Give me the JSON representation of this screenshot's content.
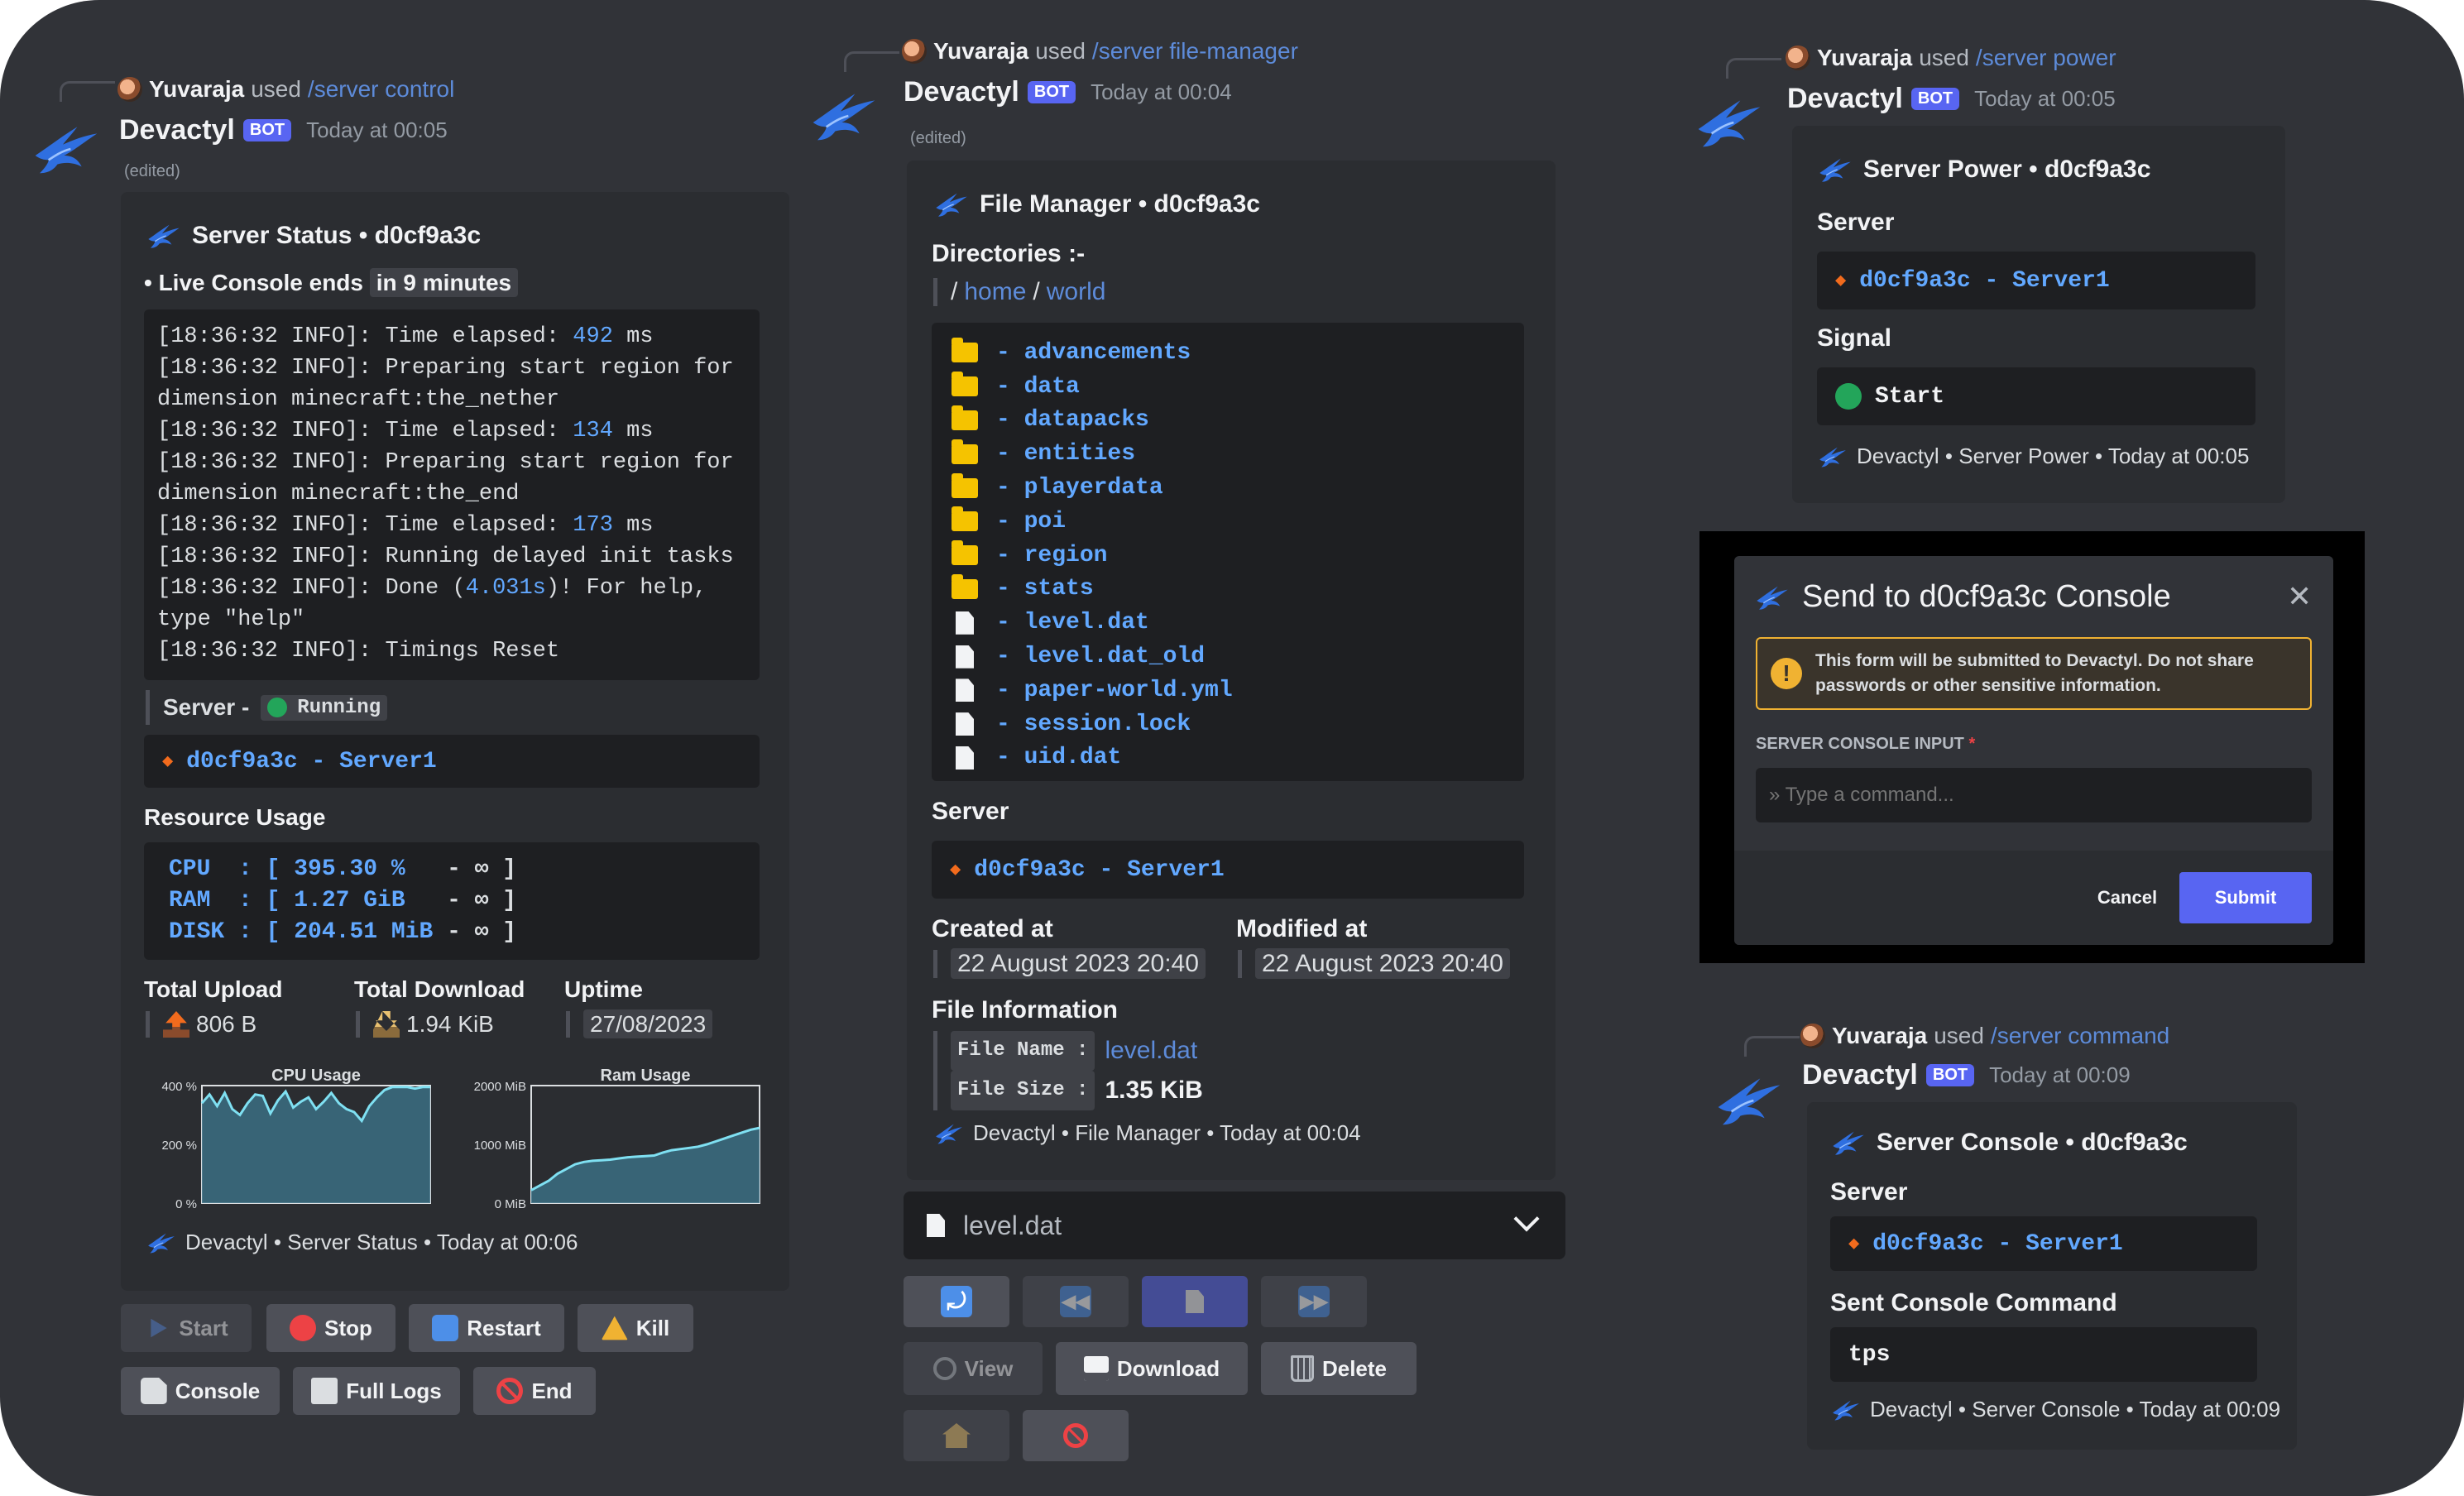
{
  "colors": {
    "background": "#313338",
    "embed": "#2b2d31",
    "code_bg": "#1e1f22",
    "link": "#5d8bd9",
    "number": "#62a8ff",
    "blurple": "#5865f2",
    "green": "#23a55a",
    "red": "#ed4245",
    "folder": "#f5c300"
  },
  "status_msg": {
    "invoker": "Yuvaraja",
    "used": "used",
    "command": "/server control",
    "author": "Devactyl",
    "bot": "BOT",
    "timestamp": "Today at 00:05",
    "edited": "(edited)",
    "embed_title": "Server Status • d0cf9a3c",
    "live_prefix": "• Live Console ends",
    "live_time": "in 9 minutes",
    "console": [
      {
        "a": "[18:36:32 INFO]: Time elapsed: ",
        "n": "492",
        "b": " ms"
      },
      {
        "a": "[18:36:32 INFO]: Preparing start region for",
        "n": "",
        "b": ""
      },
      {
        "a": "dimension minecraft:the_nether",
        "n": "",
        "b": ""
      },
      {
        "a": "[18:36:32 INFO]: Time elapsed: ",
        "n": "134",
        "b": " ms"
      },
      {
        "a": "[18:36:32 INFO]: Preparing start region for",
        "n": "",
        "b": ""
      },
      {
        "a": "dimension minecraft:the_end",
        "n": "",
        "b": ""
      },
      {
        "a": "[18:36:32 INFO]: Time elapsed: ",
        "n": "173",
        "b": " ms"
      },
      {
        "a": "[18:36:32 INFO]: Running delayed init tasks",
        "n": "",
        "b": ""
      },
      {
        "a": "[18:36:32 INFO]: Done (",
        "n": "4.031s",
        "b": ")! For help,"
      },
      {
        "a": "type \"help\"",
        "n": "",
        "b": ""
      },
      {
        "a": "[18:36:32 INFO]: Timings Reset",
        "n": "",
        "b": ""
      }
    ],
    "server_label": "Server -",
    "server_state": "Running",
    "server_line": "d0cf9a3c - Server1",
    "resource_title": "Resource Usage",
    "resources": [
      {
        "label": "CPU  : [ ",
        "value": "395.30 %  ",
        "rest": " - ∞ ]"
      },
      {
        "label": "RAM  : [ ",
        "value": "1.27 GiB  ",
        "rest": " - ∞ ]"
      },
      {
        "label": "DISK : [ ",
        "value": "204.51 MiB",
        "rest": " - ∞ ]"
      }
    ],
    "upload_label": "Total Upload",
    "upload_value": "806 B",
    "download_label": "Total Download",
    "download_value": "1.94 KiB",
    "uptime_label": "Uptime",
    "uptime_value": "27/08/2023",
    "footer": "Devactyl • Server Status • Today at 00:06",
    "buttons_row1": [
      {
        "label": "Start",
        "icon": "play-icon",
        "disabled": true
      },
      {
        "label": "Stop",
        "icon": "stop-icon"
      },
      {
        "label": "Restart",
        "icon": "restart-icon"
      },
      {
        "label": "Kill",
        "icon": "warning-icon"
      }
    ],
    "buttons_row2": [
      {
        "label": "Console",
        "icon": "document-icon"
      },
      {
        "label": "Full Logs",
        "icon": "logs-icon"
      },
      {
        "label": "End",
        "icon": "prohibited-icon"
      }
    ]
  },
  "chart_data": [
    {
      "type": "area",
      "title": "CPU Usage",
      "ylim": [
        0,
        400
      ],
      "yticks": [
        "400 %",
        "200 %",
        "0 %"
      ],
      "values": [
        340,
        370,
        330,
        375,
        320,
        300,
        340,
        370,
        365,
        305,
        350,
        380,
        325,
        345,
        360,
        320,
        345,
        375,
        340,
        320,
        310,
        280,
        330,
        360,
        385,
        395,
        395,
        395,
        390,
        395,
        395
      ]
    },
    {
      "type": "area",
      "title": "Ram Usage",
      "ylim": [
        0,
        2000
      ],
      "yticks": [
        "2000 MiB",
        "1000 MiB",
        "0 MiB"
      ],
      "values": [
        220,
        300,
        380,
        500,
        580,
        660,
        700,
        720,
        730,
        740,
        760,
        780,
        790,
        800,
        810,
        860,
        900,
        920,
        940,
        960,
        1000,
        1050,
        1100,
        1150,
        1200,
        1250,
        1280
      ]
    }
  ],
  "file_msg": {
    "invoker": "Yuvaraja",
    "used": "used",
    "command": "/server file-manager",
    "author": "Devactyl",
    "bot": "BOT",
    "timestamp": "Today at 00:04",
    "edited": "(edited)",
    "embed_title": "File Manager • d0cf9a3c",
    "dirs_label": "Directories :-",
    "path_sep1": "/",
    "path_home": "home",
    "path_sep2": "/",
    "path_world": "world",
    "files": [
      {
        "name": "- advancements",
        "kind": "folder"
      },
      {
        "name": "- data",
        "kind": "folder"
      },
      {
        "name": "- datapacks",
        "kind": "folder"
      },
      {
        "name": "- entities",
        "kind": "folder"
      },
      {
        "name": "- playerdata",
        "kind": "folder"
      },
      {
        "name": "- poi",
        "kind": "folder"
      },
      {
        "name": "- region",
        "kind": "folder"
      },
      {
        "name": "- stats",
        "kind": "folder"
      },
      {
        "name": "- level.dat",
        "kind": "file"
      },
      {
        "name": "- level.dat_old",
        "kind": "file"
      },
      {
        "name": "- paper-world.yml",
        "kind": "file"
      },
      {
        "name": "- session.lock",
        "kind": "file"
      },
      {
        "name": "- uid.dat",
        "kind": "file"
      }
    ],
    "server_label": "Server",
    "server_line": "d0cf9a3c - Server1",
    "created_label": "Created at",
    "created_value": "22 August 2023 20:40",
    "modified_label": "Modified at",
    "modified_value": "22 August 2023 20:40",
    "info_label": "File Information",
    "fname_label": "File Name :",
    "fname_value": "level.dat",
    "fsize_label": "File Size :",
    "fsize_value": "1.35 KiB",
    "footer": "Devactyl • File Manager • Today at 00:04",
    "select_value": "level.dat",
    "view_label": "View",
    "download_label": "Download",
    "delete_label": "Delete"
  },
  "power_msg": {
    "invoker": "Yuvaraja",
    "used": "used",
    "command": "/server power",
    "author": "Devactyl",
    "bot": "BOT",
    "timestamp": "Today at 00:05",
    "embed_title": "Server Power • d0cf9a3c",
    "server_label": "Server",
    "server_line": "d0cf9a3c - Server1",
    "signal_label": "Signal",
    "signal_value": "Start",
    "footer": "Devactyl • Server Power • Today at 00:05"
  },
  "modal": {
    "title": "Send to d0cf9a3c Console",
    "warning": "This form will be submitted to Devactyl. Do not share passwords or other sensitive information.",
    "input_label": "SERVER CONSOLE INPUT",
    "required": "*",
    "placeholder": "» Type a command...",
    "cancel": "Cancel",
    "submit": "Submit"
  },
  "command_msg": {
    "invoker": "Yuvaraja",
    "used": "used",
    "command": "/server command",
    "author": "Devactyl",
    "bot": "BOT",
    "timestamp": "Today at 00:09",
    "embed_title": "Server Console • d0cf9a3c",
    "server_label": "Server",
    "server_line": "d0cf9a3c - Server1",
    "sent_label": "Sent Console Command",
    "sent_value": "tps",
    "footer": "Devactyl • Server Console • Today at 00:09"
  }
}
